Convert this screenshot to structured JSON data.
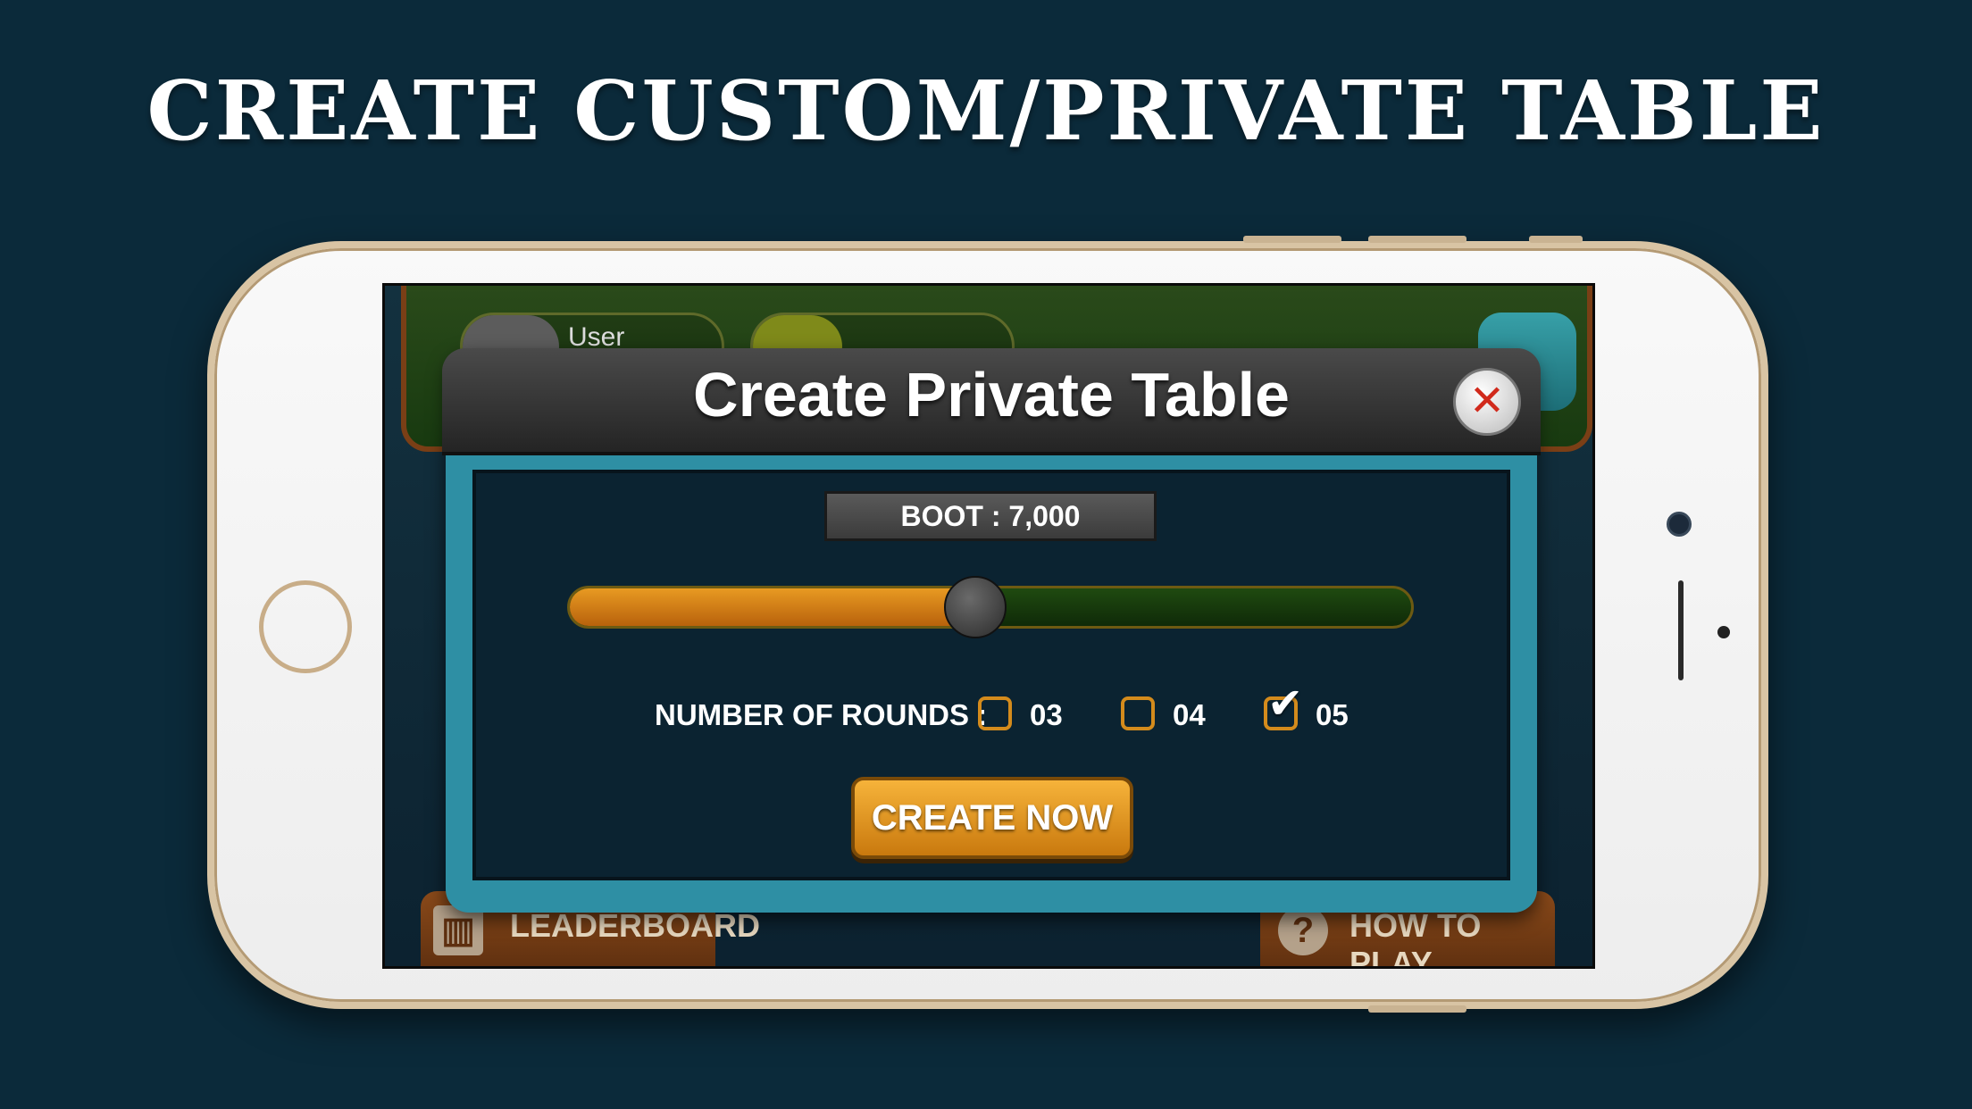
{
  "headline": "CREATE CUSTOM/PRIVATE TABLE",
  "background_color": "#0b2a3a",
  "game": {
    "top_bar": {
      "user_label": "User"
    },
    "bottom_bar": {
      "leaderboard_label": "LEADERBOARD",
      "how_to_play_label": "HOW TO PLAY"
    },
    "modal": {
      "title": "Create Private Table",
      "close_icon": "close-icon",
      "boot_label": "BOOT : 7,000",
      "slider": {
        "value_fraction": 0.48,
        "fill_color": "#e89a22",
        "track_color": "#1f4a10"
      },
      "rounds": {
        "label": "NUMBER OF ROUNDS :",
        "options": [
          {
            "label": "03",
            "checked": false
          },
          {
            "label": "04",
            "checked": false
          },
          {
            "label": "05",
            "checked": true
          }
        ]
      },
      "create_button_label": "CREATE NOW"
    }
  }
}
